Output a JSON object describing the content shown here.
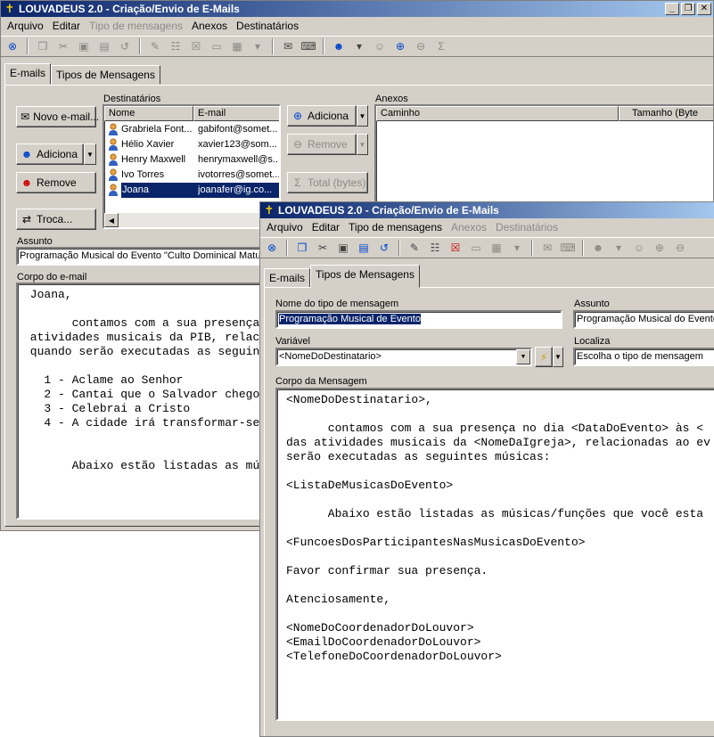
{
  "window1": {
    "title": "LOUVADEUS 2.0 - Criação/Envio de E-Mails",
    "menu": [
      "Arquivo",
      "Editar",
      "Tipo de mensagens",
      "Anexos",
      "Destinatários"
    ],
    "tabs": [
      "E-mails",
      "Tipos de Mensagens"
    ],
    "buttons": {
      "novo_email": "Novo e-mail...",
      "adiciona": "Adiciona",
      "remove": "Remove",
      "troca": "Troca...",
      "adiciona_anexo": "Adiciona",
      "remove_anexo": "Remove",
      "total_bytes": "Total (bytes)"
    },
    "destinatarios": {
      "label": "Destinatários",
      "columns": [
        "Nome",
        "E-mail"
      ],
      "rows": [
        {
          "nome": "Grabriela Font...",
          "email": "gabifont@somet..."
        },
        {
          "nome": "Hélio Xavier",
          "email": "xavier123@som..."
        },
        {
          "nome": "Henry Maxwell",
          "email": "henrymaxwell@s..."
        },
        {
          "nome": "Ivo Torres",
          "email": "ivotorres@somet..."
        },
        {
          "nome": "Joana",
          "email": "joanafer@ig.co..."
        }
      ]
    },
    "anexos": {
      "label": "Anexos",
      "columns": [
        "Caminho",
        "Tamanho (Byte"
      ]
    },
    "assunto": {
      "label": "Assunto",
      "value": "Programação Musical do Evento \"Culto Dominical Matutin"
    },
    "corpo": {
      "label": "Corpo do e-mail",
      "lines": [
        " Joana,",
        "",
        "       contamos com a sua presença",
        " atividades musicais da PIB, relac",
        " quando serão executadas as seguin",
        "",
        "   1 - Aclame ao Senhor",
        "   2 - Cantai que o Salvador chego",
        "   3 - Celebrai a Cristo",
        "   4 - A cidade irá transformar-se",
        "",
        "",
        "       Abaixo estão listadas as mú"
      ]
    }
  },
  "window2": {
    "title": "LOUVADEUS 2.0 - Criação/Envio de E-Mails",
    "menu": [
      "Arquivo",
      "Editar",
      "Tipo de mensagens",
      "Anexos",
      "Destinatários"
    ],
    "tabs": [
      "E-mails",
      "Tipos de Mensagens"
    ],
    "nome_tipo": {
      "label": "Nome do tipo de mensagem",
      "value": "Programação Musical de Evento"
    },
    "assunto": {
      "label": "Assunto",
      "value": "Programação Musical do Evento"
    },
    "variavel": {
      "label": "Variável",
      "value": "<NomeDoDestinatario>"
    },
    "localiza": {
      "label": "Localiza",
      "value": "Escolha o tipo de mensagem"
    },
    "corpo": {
      "label": "Corpo da Mensagem",
      "lines": [
        "<NomeDoDestinatario>,",
        "",
        "      contamos com a sua presença no dia <DataDoEvento> às <",
        "das atividades musicais da <NomeDaIgreja>, relacionadas ao ev",
        "serão executadas as seguintes músicas:",
        "",
        "<ListaDeMusicasDoEvento>",
        "",
        "      Abaixo estão listadas as músicas/funções que você esta",
        "",
        "<FuncoesDosParticipantesNasMusicasDoEvento>",
        "",
        "Favor confirmar sua presença.",
        "",
        "Atenciosamente,",
        "",
        "<NomeDoCoordenadorDoLouvor>",
        "<EmailDoCoordenadorDoLouvor>",
        "<TelefoneDoCoordenadorDoLouvor>"
      ]
    }
  },
  "colors": {
    "titlebar_start": "#0a246a",
    "titlebar_end": "#a6caf0",
    "window_bg": "#d4d0c8",
    "selection": "#0a246a"
  }
}
